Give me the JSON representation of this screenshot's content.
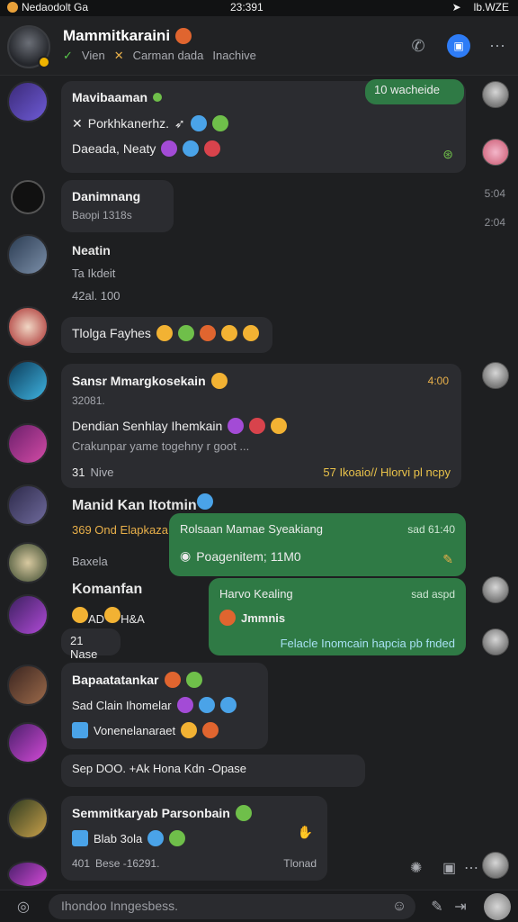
{
  "statusbar": {
    "left": "Nedaodolt Ga",
    "center": "23:391",
    "right": "lb.WZE"
  },
  "header": {
    "title": "Mammitkaraini",
    "sub_1": "Vien",
    "sub_2": "Carman dada",
    "sub_3": "Inachive"
  },
  "messages": {
    "m1": {
      "name": "Mavibaaman",
      "line1": "Porkhkanerhz.",
      "line2": "Daeada, Neaty",
      "reply": "10 wacheide"
    },
    "m2": {
      "name": "Danimnang",
      "meta": "Baopi 1318s",
      "times": [
        "5:04",
        "2:04"
      ]
    },
    "m3": {
      "name": "Neatin",
      "meta1": "Ta Ikdeit",
      "meta2": "42al. 100"
    },
    "m4": {
      "text": "Tlolga Fayhes"
    },
    "m5": {
      "name": "Sansr Mmargkosekain",
      "time": "4:00",
      "meta": "32081.",
      "line": "Dendian Senhlay Ihemkain",
      "desc": "Crakunpar yame togehny r goot ...",
      "foot_l": "Nive",
      "foot_num": "31",
      "foot_r": "57 Ikoaio// Hlorvi pl ncpy"
    },
    "m6": {
      "name": "Manid Kan Itotmin",
      "quote": "369 Ond Elapkaza",
      "green_title": "Rolsaan Mamae Syeakiang",
      "green_time": "sad 61:40",
      "green_line": "Poagenitem; 11M0"
    },
    "m7": {
      "label": "Baxela",
      "name": "Komanfan",
      "meta": "AD",
      "meta2": "H&A",
      "foot": "21 Nase",
      "green_title": "Harvo Kealing",
      "green_time": "sad aspd",
      "green_sub": "Jmmnis",
      "green_foot": "Felacle Inomcain hapcia pb fnded"
    },
    "m8": {
      "name": "Bapaatatankar",
      "line1": "Sad Clain Ihomelar",
      "line2": "Vonenelanaraet"
    },
    "m9": {
      "text": "Sep DOO. +Ak Hona Kdn -Opase"
    },
    "m10": {
      "name": "Semmitkaryab Parsonbain",
      "line1": "Blab 3ola",
      "foot_l": "Bese -16291.",
      "foot_r": "Tlonad",
      "num": "401"
    }
  },
  "composer": {
    "placeholder": "Ihondoo Inngesbess."
  }
}
